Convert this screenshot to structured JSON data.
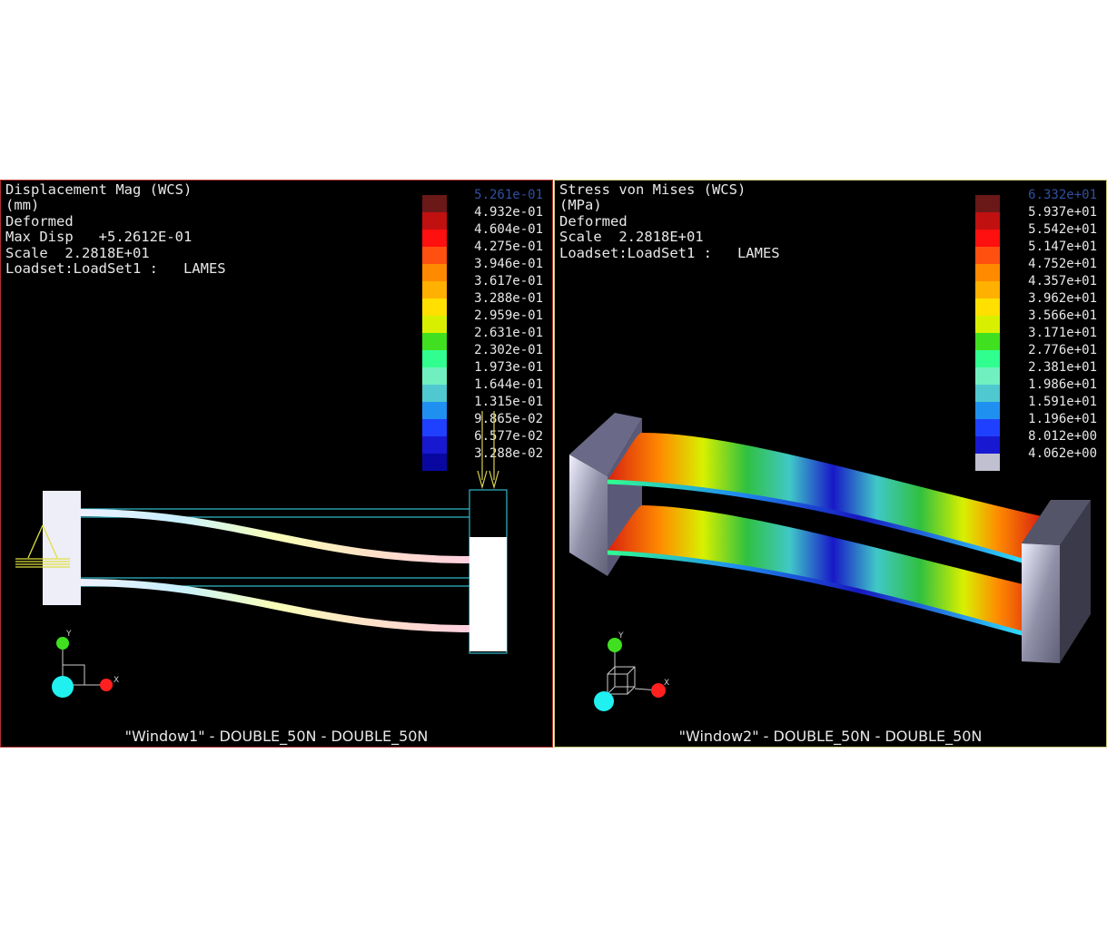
{
  "window1": {
    "info_lines": [
      "Displacement Mag (WCS)",
      "(mm)",
      "Deformed",
      "Max Disp   +5.2612E-01",
      "Scale  2.2818E+01",
      "Loadset:LoadSet1 :   LAMES"
    ],
    "legend_top": "5.261e-01",
    "legend_values": [
      "4.932e-01",
      "4.604e-01",
      "4.275e-01",
      "3.946e-01",
      "3.617e-01",
      "3.288e-01",
      "2.959e-01",
      "2.631e-01",
      "2.302e-01",
      "1.973e-01",
      "1.644e-01",
      "1.315e-01",
      "9.865e-02",
      "6.577e-02",
      "3.288e-02"
    ],
    "legend_colors": [
      "#6a1818",
      "#c01010",
      "#ff1010",
      "#ff5010",
      "#ff8a00",
      "#ffb000",
      "#ffe000",
      "#d8f000",
      "#40e020",
      "#30ff90",
      "#70f0c0",
      "#50c8d0",
      "#2090f0",
      "#2040ff",
      "#1818d0",
      "#0808a0"
    ],
    "axis": {
      "y": "Y",
      "x": "X"
    },
    "caption": "\"Window1\" - DOUBLE_50N - DOUBLE_50N"
  },
  "window2": {
    "info_lines": [
      "Stress von Mises (WCS)",
      "(MPa)",
      "Deformed",
      "Scale  2.2818E+01",
      "Loadset:LoadSet1 :   LAMES"
    ],
    "legend_top": "6.332e+01",
    "legend_values": [
      "5.937e+01",
      "5.542e+01",
      "5.147e+01",
      "4.752e+01",
      "4.357e+01",
      "3.962e+01",
      "3.566e+01",
      "3.171e+01",
      "2.776e+01",
      "2.381e+01",
      "1.986e+01",
      "1.591e+01",
      "1.196e+01",
      "8.012e+00",
      "4.062e+00"
    ],
    "legend_colors": [
      "#6a1818",
      "#c01010",
      "#ff1010",
      "#ff5010",
      "#ff8a00",
      "#ffb000",
      "#ffe000",
      "#d8f000",
      "#40e020",
      "#30ff90",
      "#70f0c0",
      "#50c8d0",
      "#2090f0",
      "#2040ff",
      "#1818d0",
      "#c0c0d0"
    ],
    "axis": {
      "y": "Y",
      "x": "X"
    },
    "caption": "\"Window2\" - DOUBLE_50N - DOUBLE_50N"
  }
}
